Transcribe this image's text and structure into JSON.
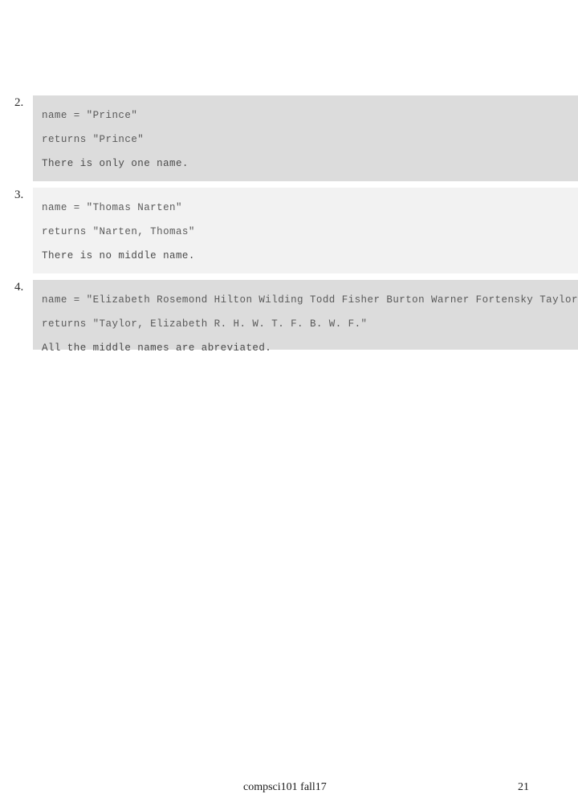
{
  "slide": {
    "background_color": "#ffffff",
    "block_color_dark": "#dcdcdc",
    "block_color_light": "#f2f2f2",
    "code_text_color": "#5a5a5a"
  },
  "examples": [
    {
      "number": "2.",
      "tone": "dark",
      "lines": [
        "name = \"Prince\"",
        "returns \"Prince\"",
        "There is only one name."
      ]
    },
    {
      "number": "3.",
      "tone": "light",
      "lines": [
        "name = \"Thomas Narten\"",
        "returns \"Narten, Thomas\"",
        "There is no middle name."
      ]
    },
    {
      "number": "4.",
      "tone": "dark",
      "lines": [
        "name = \"Elizabeth Rosemond Hilton Wilding Todd Fisher Burton Warner Fortensky Taylor\"",
        "returns \"Taylor, Elizabeth R. H. W. T. F. B. W. F.\"",
        "All the middle names are abreviated."
      ]
    }
  ],
  "footer": {
    "course": "compsci101 fall17",
    "page_number": "21"
  }
}
